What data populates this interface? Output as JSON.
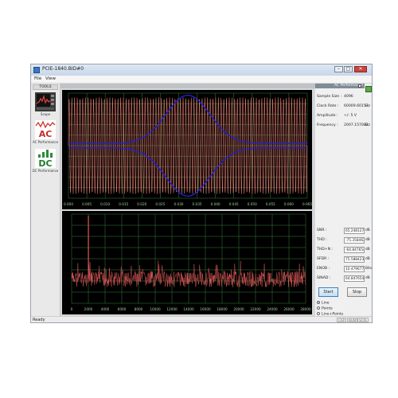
{
  "window": {
    "title": "PCIE-1840.BID#0",
    "min_glyph": "–",
    "max_glyph": "□",
    "close_glyph": "✕"
  },
  "menu": {
    "items": [
      "File",
      "View"
    ]
  },
  "tools": {
    "header": "TOOLS",
    "items": [
      {
        "label": "Scope",
        "icon": "scope-icon"
      },
      {
        "label": "AC Performance",
        "icon": "ac-icon",
        "glyph": "AC"
      },
      {
        "label": "DC Performance",
        "icon": "dc-icon",
        "glyph": "DC"
      }
    ]
  },
  "top_plot": {
    "x_ticks": [
      "0.000",
      "0.005",
      "0.010",
      "0.015",
      "0.020",
      "0.025",
      "0.030",
      "0.035",
      "0.040",
      "0.045",
      "0.050",
      "0.055",
      "0.060",
      "0.065"
    ],
    "trace_color": "#d9776b",
    "envelope_color": "#2222c8",
    "grid_color": "#3d7d3d"
  },
  "bottom_plot": {
    "x_ticks": [
      "0",
      "2000",
      "4000",
      "6000",
      "8000",
      "10000",
      "12000",
      "14000",
      "16000",
      "18000",
      "20000",
      "22000",
      "24000",
      "26000",
      "28000"
    ],
    "trace_color": "#e05a5a"
  },
  "ac_panel": {
    "title": "AC Performance",
    "sample_size_label": "Sample Size :",
    "sample_size_value": "4096",
    "clock_rate_label": "Clock Rate :",
    "clock_rate_value": "60009.60153",
    "clock_rate_unit": "Hz",
    "amplitude_label": "Amplitude :",
    "amplitude_value": "+/- 5 V",
    "frequency_label": "Frequency :",
    "frequency_value": "2007.157082",
    "frequency_unit": "Hz",
    "metrics": [
      {
        "label": "SNR :",
        "value": "65.248127",
        "unit": "dB"
      },
      {
        "label": "THD :",
        "value": "-75.358462",
        "unit": "dB"
      },
      {
        "label": "THD+N :",
        "value": "-64.847654",
        "unit": "dB"
      },
      {
        "label": "SFDR :",
        "value": "75.588423",
        "unit": "dB"
      },
      {
        "label": "ENOB :",
        "value": "10.479677",
        "unit": "Bits"
      },
      {
        "label": "SINAD :",
        "value": "64.847654",
        "unit": "dB"
      }
    ],
    "start_label": "Start",
    "stop_label": "Stop",
    "display_modes": [
      {
        "label": "Line",
        "selected": true
      },
      {
        "label": "Points",
        "selected": false
      },
      {
        "label": "Line+Points",
        "selected": false
      }
    ]
  },
  "status": {
    "text": "Ready",
    "indicators": [
      "CAP",
      "NUM",
      "SCRL"
    ]
  }
}
